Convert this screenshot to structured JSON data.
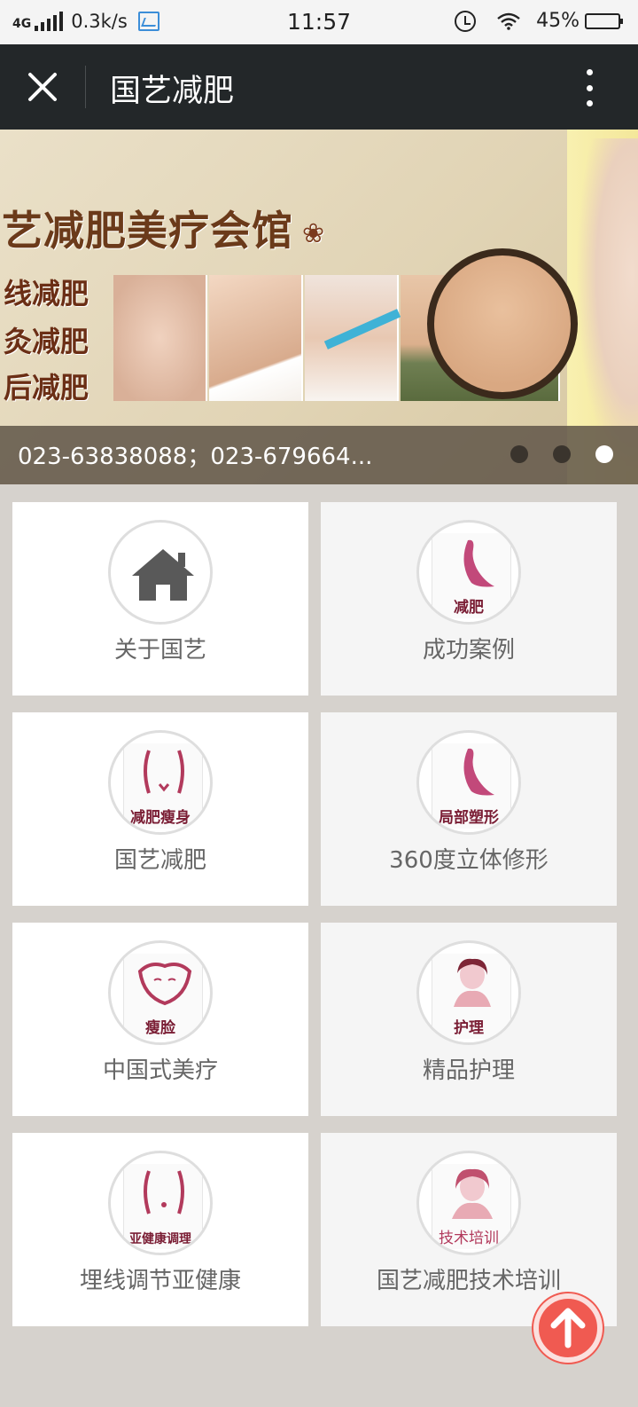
{
  "status_bar": {
    "network": "4G",
    "speed": "0.3k/s",
    "time": "11:57",
    "battery": "45%",
    "battery_level": 0.45
  },
  "navbar": {
    "title": "国艺减肥"
  },
  "banner": {
    "headline": "艺减肥美疗会馆",
    "lines": [
      "线减肥",
      "灸减肥",
      "后减肥"
    ],
    "caption": "023-63838088；023-679664...",
    "slide_count": 3,
    "active_slide": 3
  },
  "menu": [
    {
      "label": "关于国艺",
      "icon": "house-icon",
      "icon_text": ""
    },
    {
      "label": "成功案例",
      "icon": "silhouette-icon",
      "icon_text": "减肥"
    },
    {
      "label": "国艺减肥",
      "icon": "waist-icon",
      "icon_text": "减肥瘦身"
    },
    {
      "label": "360度立体修形",
      "icon": "silhouette-icon",
      "icon_text": "局部塑形"
    },
    {
      "label": "中国式美疗",
      "icon": "face-icon",
      "icon_text": "瘦脸"
    },
    {
      "label": "精品护理",
      "icon": "woman-portrait-icon",
      "icon_text": "护理"
    },
    {
      "label": "埋线调节亚健康",
      "icon": "waist-icon",
      "icon_text": "亚健康调理"
    },
    {
      "label": "国艺减肥技术培训",
      "icon": "woman-portrait-icon",
      "icon_text": "技术培训"
    }
  ]
}
